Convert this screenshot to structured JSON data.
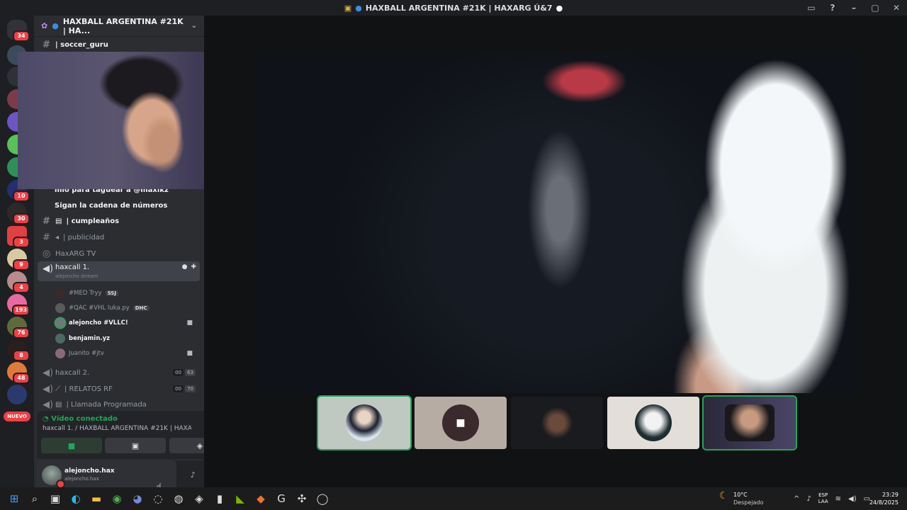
{
  "window": {
    "title": "HAXBALL ARGENTINA #21K | HAXARG Ú&7",
    "controls": [
      "inbox",
      "help",
      "minimize",
      "maximize",
      "close"
    ]
  },
  "server": {
    "name": "HAXBALL ARGENTINA #21K | HA..."
  },
  "rail_badges": [
    "34",
    "10",
    "30",
    "3",
    "9",
    "4",
    "193",
    "76",
    "8",
    "48"
  ],
  "rail_new_label": "NUEVO",
  "channels": {
    "soccer_guru": "| soccer_guru",
    "partial_line": "mio para taguear a @maxikz",
    "sigan": "Sigan la cadena de números",
    "cumpleanos": "| cumpleaños",
    "publicidad": "| publicidad",
    "haxarg_tv": "HaxARG TV",
    "haxcall1": "haxcall 1.",
    "haxcall1_sub": "alejoncho stream",
    "haxcall2": "haxcall 2.",
    "haxcall2_counts": [
      "00",
      "63"
    ],
    "relatos": "| RELATOS RF",
    "relatos_counts": [
      "00",
      "70"
    ],
    "llamada": "| Llamada Programada"
  },
  "members": [
    {
      "name": "#MED Tryy",
      "tag": "SSJ"
    },
    {
      "name": "#QAC #VHL luka.py",
      "tag": "DHC"
    },
    {
      "name": "alejoncho #VLLC!",
      "tag": ""
    },
    {
      "name": "benjamin.yz",
      "tag": ""
    },
    {
      "name": "Juanito #jtv",
      "tag": ""
    }
  ],
  "voice": {
    "status": "Vídeo conectado",
    "location": "haxcall 1. / HAXBALL ARGENTINA #21K | HAXA..."
  },
  "user": {
    "name": "alejoncho.hax",
    "tag": "alejoncho.hax"
  },
  "taskbar": {
    "temp": "10°C",
    "weather": "Despejado",
    "lang_top": "ESP",
    "lang_bottom": "LAA",
    "time": "23:29",
    "date": "24/8/2025"
  },
  "colors": {
    "connected_green": "#23a55a",
    "badge_red": "#f23f43",
    "sidebar_bg": "#2b2d31",
    "rail_bg": "#1e1f22"
  }
}
